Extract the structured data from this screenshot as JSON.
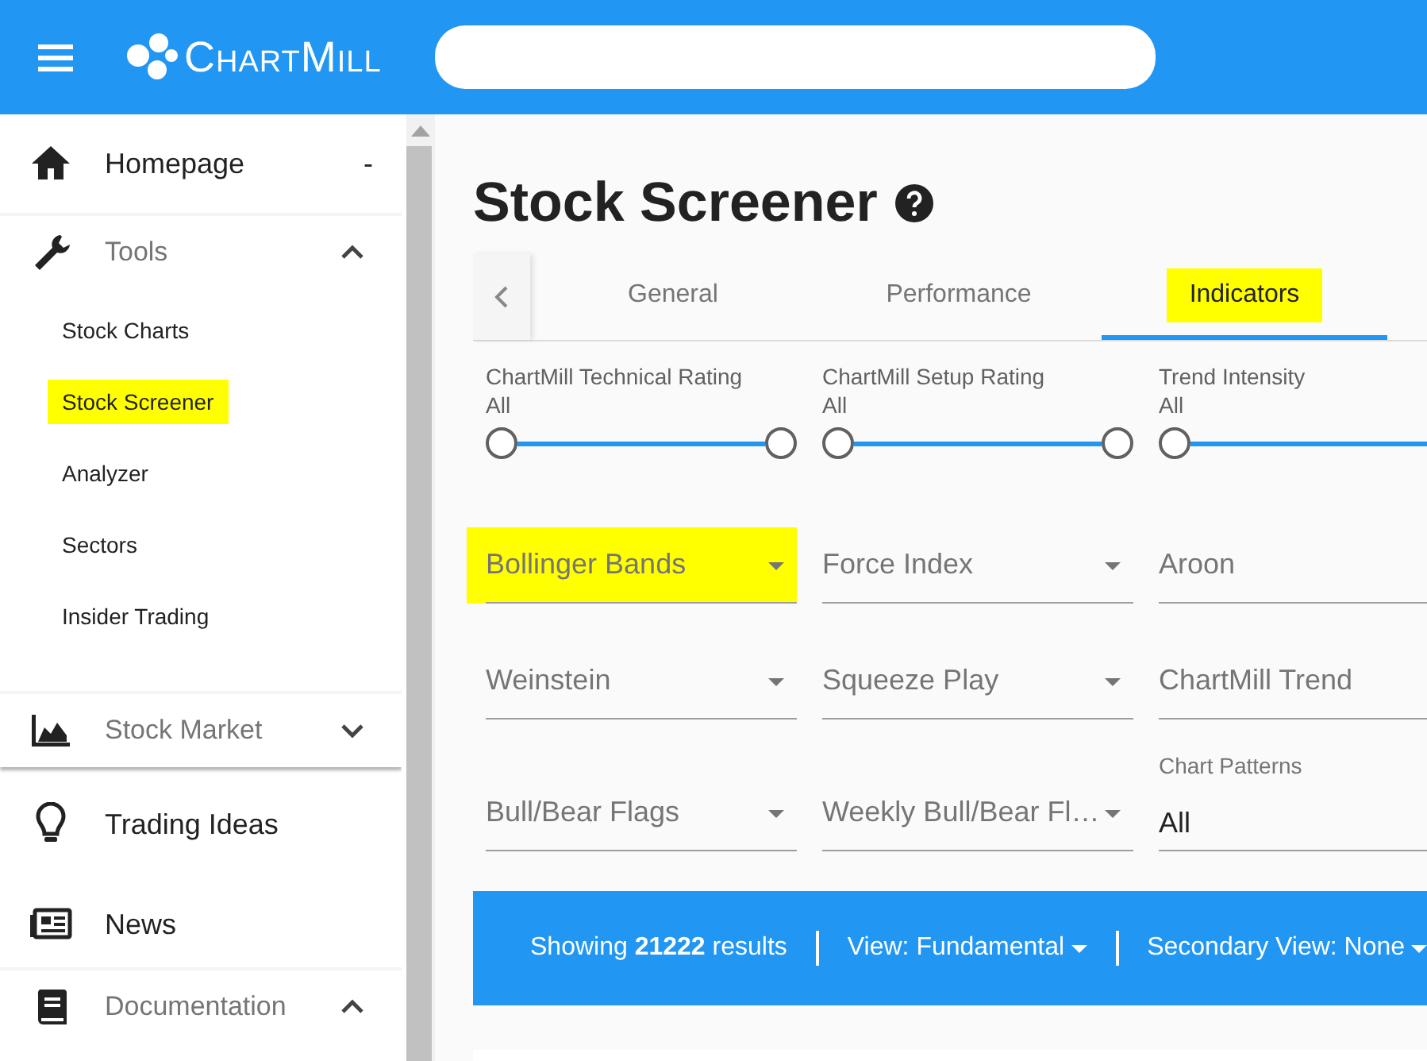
{
  "header": {
    "logo": "ChartMill"
  },
  "sidebar": {
    "items": [
      {
        "label": "Homepage",
        "kind": "link",
        "trail": "-"
      },
      {
        "label": "Tools",
        "kind": "section",
        "expanded": true,
        "children": [
          {
            "label": "Stock Charts",
            "highlighted": false
          },
          {
            "label": "Stock Screener",
            "highlighted": true
          },
          {
            "label": "Analyzer",
            "highlighted": false
          },
          {
            "label": "Sectors",
            "highlighted": false
          },
          {
            "label": "Insider Trading",
            "highlighted": false
          }
        ]
      },
      {
        "label": "Stock Market",
        "kind": "section",
        "expanded": false
      },
      {
        "label": "Trading Ideas",
        "kind": "link"
      },
      {
        "label": "News",
        "kind": "link"
      },
      {
        "label": "Documentation",
        "kind": "section",
        "expanded": true
      }
    ]
  },
  "page": {
    "title": "Stock Screener"
  },
  "tabs": [
    {
      "label": "General",
      "selected": false,
      "highlighted": false
    },
    {
      "label": "Performance",
      "selected": false,
      "highlighted": false
    },
    {
      "label": "Indicators",
      "selected": true,
      "highlighted": true
    }
  ],
  "sliders": [
    {
      "label": "ChartMill Technical Rating",
      "value": "All"
    },
    {
      "label": "ChartMill Setup Rating",
      "value": "All"
    },
    {
      "label": "Trend Intensity",
      "value": "All"
    }
  ],
  "filter_rows": [
    [
      {
        "kind": "select",
        "label": "Bollinger Bands",
        "highlighted": true
      },
      {
        "kind": "select",
        "label": "Force Index",
        "highlighted": false
      },
      {
        "kind": "select",
        "label": "Aroon",
        "highlighted": false
      }
    ],
    [
      {
        "kind": "select",
        "label": "Weinstein",
        "highlighted": false
      },
      {
        "kind": "select",
        "label": "Squeeze Play",
        "highlighted": false
      },
      {
        "kind": "select",
        "label": "ChartMill Trend",
        "highlighted": false
      }
    ],
    [
      {
        "kind": "select",
        "label": "Bull/Bear Flags",
        "highlighted": false
      },
      {
        "kind": "select",
        "label": "Weekly Bull/Bear Fl…",
        "highlighted": false
      },
      {
        "kind": "filled",
        "label": "Chart Patterns",
        "value": "All",
        "highlighted": false
      }
    ]
  ],
  "results_bar": {
    "count": "Showing **21222** results",
    "view": "View: Fundamental",
    "secondary_view": "Secondary View: None"
  }
}
